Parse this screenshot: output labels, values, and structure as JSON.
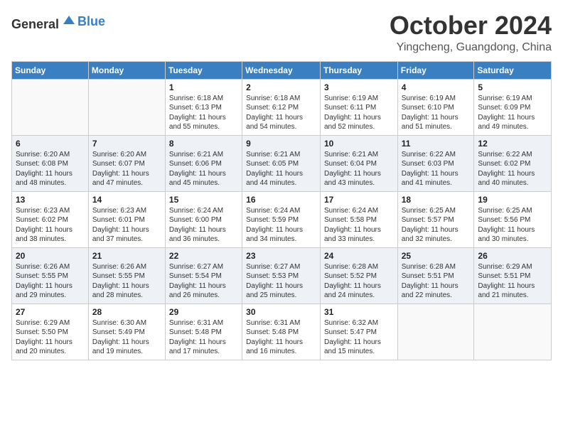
{
  "header": {
    "logo_general": "General",
    "logo_blue": "Blue",
    "month": "October 2024",
    "location": "Yingcheng, Guangdong, China"
  },
  "days_of_week": [
    "Sunday",
    "Monday",
    "Tuesday",
    "Wednesday",
    "Thursday",
    "Friday",
    "Saturday"
  ],
  "weeks": [
    [
      {
        "day": "",
        "info": ""
      },
      {
        "day": "",
        "info": ""
      },
      {
        "day": "1",
        "info": "Sunrise: 6:18 AM\nSunset: 6:13 PM\nDaylight: 11 hours and 55 minutes."
      },
      {
        "day": "2",
        "info": "Sunrise: 6:18 AM\nSunset: 6:12 PM\nDaylight: 11 hours and 54 minutes."
      },
      {
        "day": "3",
        "info": "Sunrise: 6:19 AM\nSunset: 6:11 PM\nDaylight: 11 hours and 52 minutes."
      },
      {
        "day": "4",
        "info": "Sunrise: 6:19 AM\nSunset: 6:10 PM\nDaylight: 11 hours and 51 minutes."
      },
      {
        "day": "5",
        "info": "Sunrise: 6:19 AM\nSunset: 6:09 PM\nDaylight: 11 hours and 49 minutes."
      }
    ],
    [
      {
        "day": "6",
        "info": "Sunrise: 6:20 AM\nSunset: 6:08 PM\nDaylight: 11 hours and 48 minutes."
      },
      {
        "day": "7",
        "info": "Sunrise: 6:20 AM\nSunset: 6:07 PM\nDaylight: 11 hours and 47 minutes."
      },
      {
        "day": "8",
        "info": "Sunrise: 6:21 AM\nSunset: 6:06 PM\nDaylight: 11 hours and 45 minutes."
      },
      {
        "day": "9",
        "info": "Sunrise: 6:21 AM\nSunset: 6:05 PM\nDaylight: 11 hours and 44 minutes."
      },
      {
        "day": "10",
        "info": "Sunrise: 6:21 AM\nSunset: 6:04 PM\nDaylight: 11 hours and 43 minutes."
      },
      {
        "day": "11",
        "info": "Sunrise: 6:22 AM\nSunset: 6:03 PM\nDaylight: 11 hours and 41 minutes."
      },
      {
        "day": "12",
        "info": "Sunrise: 6:22 AM\nSunset: 6:02 PM\nDaylight: 11 hours and 40 minutes."
      }
    ],
    [
      {
        "day": "13",
        "info": "Sunrise: 6:23 AM\nSunset: 6:02 PM\nDaylight: 11 hours and 38 minutes."
      },
      {
        "day": "14",
        "info": "Sunrise: 6:23 AM\nSunset: 6:01 PM\nDaylight: 11 hours and 37 minutes."
      },
      {
        "day": "15",
        "info": "Sunrise: 6:24 AM\nSunset: 6:00 PM\nDaylight: 11 hours and 36 minutes."
      },
      {
        "day": "16",
        "info": "Sunrise: 6:24 AM\nSunset: 5:59 PM\nDaylight: 11 hours and 34 minutes."
      },
      {
        "day": "17",
        "info": "Sunrise: 6:24 AM\nSunset: 5:58 PM\nDaylight: 11 hours and 33 minutes."
      },
      {
        "day": "18",
        "info": "Sunrise: 6:25 AM\nSunset: 5:57 PM\nDaylight: 11 hours and 32 minutes."
      },
      {
        "day": "19",
        "info": "Sunrise: 6:25 AM\nSunset: 5:56 PM\nDaylight: 11 hours and 30 minutes."
      }
    ],
    [
      {
        "day": "20",
        "info": "Sunrise: 6:26 AM\nSunset: 5:55 PM\nDaylight: 11 hours and 29 minutes."
      },
      {
        "day": "21",
        "info": "Sunrise: 6:26 AM\nSunset: 5:55 PM\nDaylight: 11 hours and 28 minutes."
      },
      {
        "day": "22",
        "info": "Sunrise: 6:27 AM\nSunset: 5:54 PM\nDaylight: 11 hours and 26 minutes."
      },
      {
        "day": "23",
        "info": "Sunrise: 6:27 AM\nSunset: 5:53 PM\nDaylight: 11 hours and 25 minutes."
      },
      {
        "day": "24",
        "info": "Sunrise: 6:28 AM\nSunset: 5:52 PM\nDaylight: 11 hours and 24 minutes."
      },
      {
        "day": "25",
        "info": "Sunrise: 6:28 AM\nSunset: 5:51 PM\nDaylight: 11 hours and 22 minutes."
      },
      {
        "day": "26",
        "info": "Sunrise: 6:29 AM\nSunset: 5:51 PM\nDaylight: 11 hours and 21 minutes."
      }
    ],
    [
      {
        "day": "27",
        "info": "Sunrise: 6:29 AM\nSunset: 5:50 PM\nDaylight: 11 hours and 20 minutes."
      },
      {
        "day": "28",
        "info": "Sunrise: 6:30 AM\nSunset: 5:49 PM\nDaylight: 11 hours and 19 minutes."
      },
      {
        "day": "29",
        "info": "Sunrise: 6:31 AM\nSunset: 5:48 PM\nDaylight: 11 hours and 17 minutes."
      },
      {
        "day": "30",
        "info": "Sunrise: 6:31 AM\nSunset: 5:48 PM\nDaylight: 11 hours and 16 minutes."
      },
      {
        "day": "31",
        "info": "Sunrise: 6:32 AM\nSunset: 5:47 PM\nDaylight: 11 hours and 15 minutes."
      },
      {
        "day": "",
        "info": ""
      },
      {
        "day": "",
        "info": ""
      }
    ]
  ]
}
